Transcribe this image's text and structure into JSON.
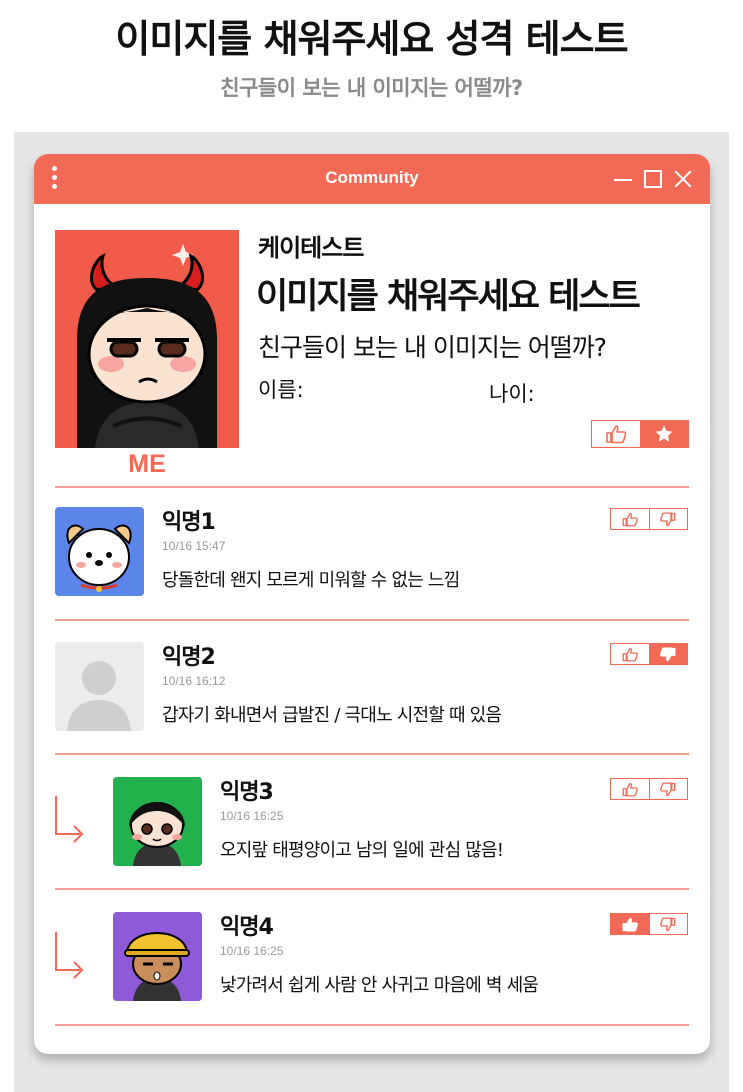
{
  "header": {
    "title": "이미지를 채워주세요 성격 테스트",
    "subtitle": "친구들이 보는 내 이미지는 어떨까?"
  },
  "window": {
    "title": "Community",
    "menu_icon": "kebab-menu-icon",
    "controls": [
      "minimize-icon",
      "maximize-icon",
      "close-icon"
    ],
    "accent_color": "#f26a55"
  },
  "profile": {
    "me_label": "ME",
    "brand": "케이테스트",
    "title": "이미지를 채워주세요 테스트",
    "subtitle": "친구들이 보는 내 이미지는 어떨까?",
    "name_label": "이름:",
    "age_label": "나이:",
    "actions": [
      "thumbs-up-icon",
      "star-icon"
    ]
  },
  "comments": [
    {
      "name": "익명1",
      "time": "10/16  15:47",
      "text": "당돌한데 왠지 모르게 미워할 수 없는 느낌",
      "reply": false,
      "vote": "none",
      "avatar": "puppy"
    },
    {
      "name": "익명2",
      "time": "10/16  16:12",
      "text": "갑자기 화내면서 급발진 / 극대노 시전할 때 있음",
      "reply": false,
      "vote": "down",
      "avatar": "default"
    },
    {
      "name": "익명3",
      "time": "10/16  16:25",
      "text": "오지랖 태평양이고 남의 일에 관심 많음!",
      "reply": true,
      "vote": "none",
      "avatar": "girl-green"
    },
    {
      "name": "익명4",
      "time": "10/16  16:25",
      "text": "낯가려서 쉽게 사람 안 사귀고 마음에 벽 세움",
      "reply": true,
      "vote": "up",
      "avatar": "helmet"
    }
  ]
}
